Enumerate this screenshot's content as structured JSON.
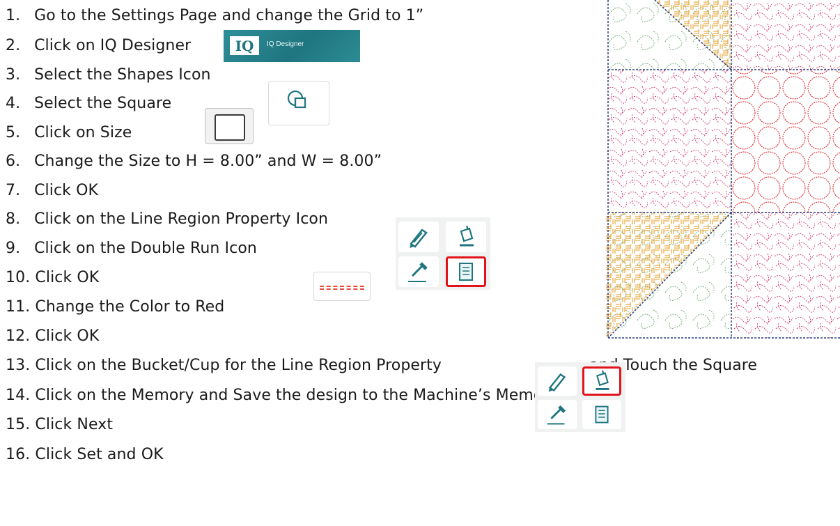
{
  "steps": [
    {
      "num": "1.",
      "text": "Go to the Settings Page and change the Grid to 1”"
    },
    {
      "num": "2.",
      "text": "Click on IQ Designer"
    },
    {
      "num": "3.",
      "text": "Select the Shapes Icon"
    },
    {
      "num": "4.",
      "text": "Select the Square"
    },
    {
      "num": "5.",
      "text": "Click on Size"
    },
    {
      "num": "6.",
      "text": "Change the Size to H = 8.00” and W = 8.00”"
    },
    {
      "num": "7.",
      "text": "Click OK"
    },
    {
      "num": "8.",
      "text": "Click on the Line Region Property Icon"
    },
    {
      "num": "9.",
      "text": "Click on the Double Run Icon"
    },
    {
      "num": "10.",
      "text": "Click OK"
    },
    {
      "num": "11.",
      "text": "Change the Color to Red"
    },
    {
      "num": "12.",
      "text": "Click OK"
    },
    {
      "num": "13.",
      "text": "Click on the Bucket/Cup for the Line Region Property",
      "suffix": "and Touch the Square"
    },
    {
      "num": "14.",
      "text": "Click on the Memory and Save the design to the Machine’s Memory"
    },
    {
      "num": "15.",
      "text": "Click Next"
    },
    {
      "num": "16.",
      "text": "Click Set and OK"
    }
  ],
  "icons": {
    "iq_designer": {
      "logo": "IQ",
      "label": "IQ Designer"
    },
    "shapes": "shapes-icon",
    "square": "square-icon",
    "line_region_panel": [
      "pen-icon",
      "bucket-icon",
      "eyedropper-icon",
      "line-property-icon"
    ],
    "double_run": "double-run-icon"
  },
  "colors": {
    "accent_teal": "#1f7580",
    "highlight_red": "#e0141a",
    "quilt_pink": "#d23a6a",
    "quilt_orange": "#e39a1a",
    "quilt_green": "#6aa56a",
    "quilt_navy": "#2a3f7a"
  }
}
